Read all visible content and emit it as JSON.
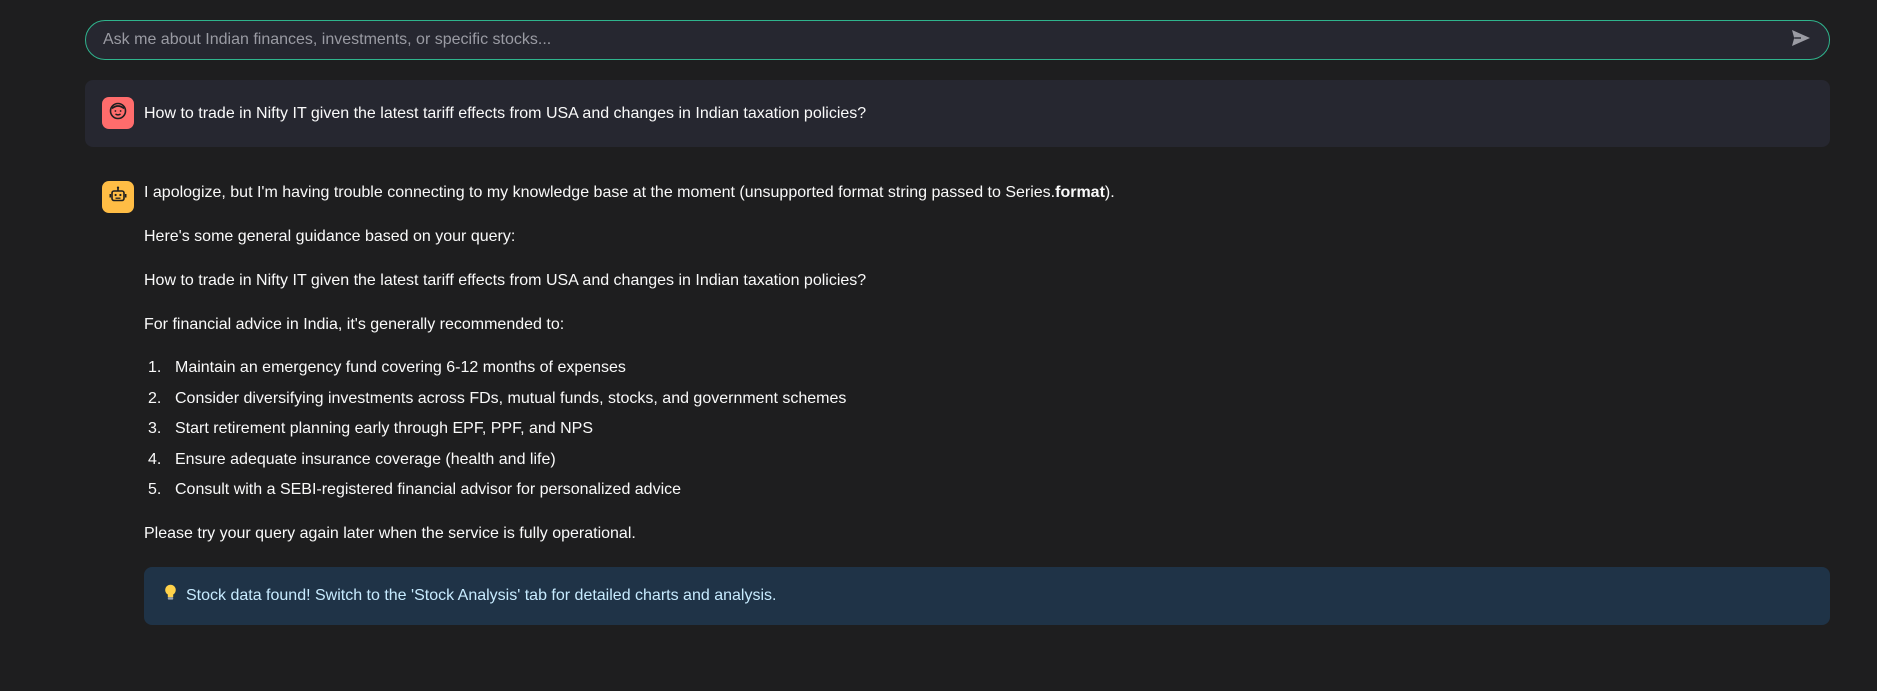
{
  "chat_input": {
    "placeholder": "Ask me about Indian finances, investments, or specific stocks...",
    "value": "",
    "send_icon": "send-icon"
  },
  "messages": [
    {
      "role": "user",
      "avatar_icon": "user-face-icon",
      "text": "How to trade in Nifty IT given the latest tariff effects from USA and changes in Indian taxation policies?"
    },
    {
      "role": "assistant",
      "avatar_icon": "robot-icon",
      "p1_start": "I apologize, but I'm having trouble connecting to my knowledge base at the moment (unsupported format string passed to Series.",
      "p1_bold": "format",
      "p1_end": ").",
      "p2": "Here's some general guidance based on your query:",
      "p3": "How to trade in Nifty IT given the latest tariff effects from USA and changes in Indian taxation policies?",
      "p4": "For financial advice in India, it's generally recommended to:",
      "steps": [
        {
          "num": "1.",
          "text": "Maintain an emergency fund covering 6-12 months of expenses"
        },
        {
          "num": "2.",
          "text": "Consider diversifying investments across FDs, mutual funds, stocks, and government schemes"
        },
        {
          "num": "3.",
          "text": "Start retirement planning early through EPF, PPF, and NPS"
        },
        {
          "num": "4.",
          "text": "Ensure adequate insurance coverage (health and life)"
        },
        {
          "num": "5.",
          "text": "Consult with a SEBI-registered financial advisor for personalized advice"
        }
      ],
      "p5": "Please try your query again later when the service is fully operational."
    }
  ],
  "info_box": {
    "icon": "lightbulb-icon",
    "text": "Stock data found! Switch to the 'Stock Analysis' tab for detailed charts and analysis."
  },
  "colors": {
    "background": "#1e1e1f",
    "input_border": "#2fb48d",
    "user_avatar": "#ff6c6c",
    "bot_avatar": "#ffbd45",
    "info_bg": "#1f3347",
    "info_text": "#c7ebff"
  }
}
